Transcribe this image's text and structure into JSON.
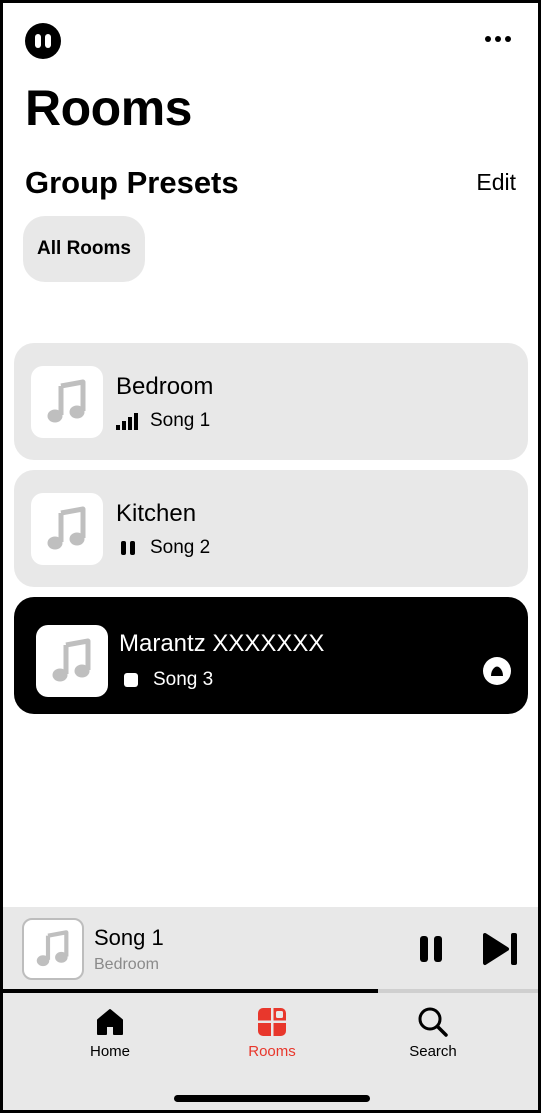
{
  "header": {
    "logo_icon": "pause-circle-logo-icon",
    "more_icon": "more-horizontal-icon"
  },
  "page": {
    "title": "Rooms"
  },
  "presets": {
    "title": "Group Presets",
    "edit_label": "Edit",
    "items": [
      {
        "label": "All Rooms"
      }
    ]
  },
  "rooms": [
    {
      "name": "Bedroom",
      "song": "Song 1",
      "status": "playing",
      "status_icon": "signal-bars-icon",
      "art_icon": "music-note-icon",
      "active": false
    },
    {
      "name": "Kitchen",
      "song": "Song 2",
      "status": "paused",
      "status_icon": "pause-icon",
      "art_icon": "music-note-icon",
      "active": false
    },
    {
      "name": "Marantz XXXXXXX",
      "song": "Song 3",
      "status": "stopped",
      "status_icon": "stop-icon",
      "art_icon": "music-note-icon",
      "active": true,
      "source_icon": "eject-source-icon"
    }
  ],
  "now_playing": {
    "title": "Song 1",
    "room": "Bedroom",
    "progress": 0.7,
    "pause_icon": "pause-icon",
    "next_icon": "skip-next-icon"
  },
  "tabs": [
    {
      "label": "Home",
      "icon": "home-icon",
      "active": false
    },
    {
      "label": "Rooms",
      "icon": "rooms-grid-icon",
      "active": true
    },
    {
      "label": "Search",
      "icon": "search-icon",
      "active": false
    }
  ],
  "colors": {
    "accent": "#e8372c",
    "card_bg": "#e8e8e8",
    "active_card_bg": "#000000",
    "secondary_text": "#8a8a8a",
    "art_note": "#bfbfbf"
  }
}
